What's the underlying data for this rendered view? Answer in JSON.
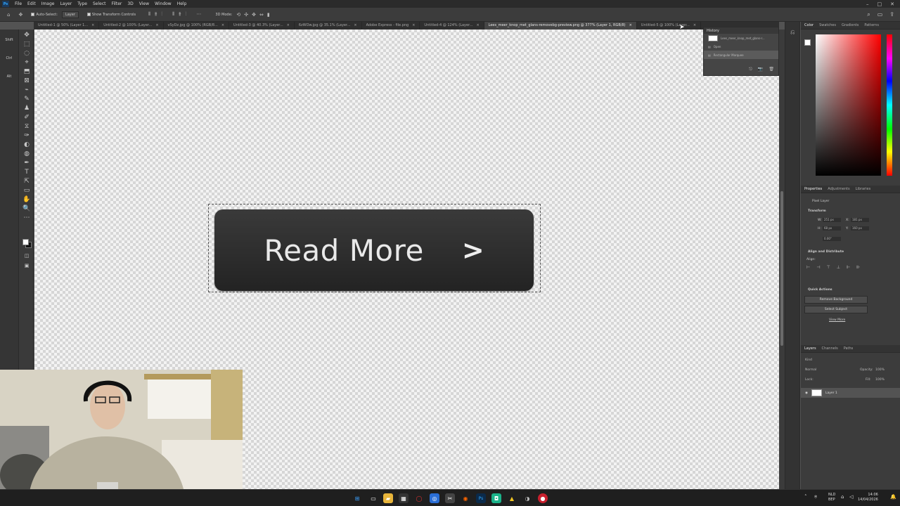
{
  "menubar": {
    "items": [
      "File",
      "Edit",
      "Image",
      "Layer",
      "Type",
      "Select",
      "Filter",
      "3D",
      "View",
      "Window",
      "Help"
    ],
    "win_controls": [
      "–",
      "□",
      "✕"
    ]
  },
  "options": {
    "auto_select_label": "Auto-Select:",
    "auto_select_value": "Layer",
    "transform_controls_label": "Show Transform Controls",
    "mode_3d_label": "3D Mode:"
  },
  "tabs": [
    {
      "label": "Untitled-1 @ 50% (Layer 1...",
      "active": false
    },
    {
      "label": "Untitled-2 @ 100% (Layer...",
      "active": false
    },
    {
      "label": "vSyDz.jpg @ 100% (RGB/8...",
      "active": false
    },
    {
      "label": "Untitled-3 @ 40.3% (Layer...",
      "active": false
    },
    {
      "label": "6zWOw.jpg @ 35.1% (Layer...",
      "active": false
    },
    {
      "label": "Adobe Express - file.png",
      "active": false
    },
    {
      "label": "Untitled-4 @ 124% (Layer...",
      "active": false
    },
    {
      "label": "Lees_meer_knop_met_glans-removebg-preview.png @ 377% (Layer 1, RGB/8)",
      "active": true
    },
    {
      "label": "Untitled-5 @ 100% (Layer...",
      "active": false
    }
  ],
  "tab_close": "×",
  "left_strip": [
    "Shift",
    "Ctrl",
    "Alt"
  ],
  "tools": [
    "✥",
    "⬚",
    "◌",
    "⌖",
    "⬒",
    "⊠",
    "⌁",
    "✎",
    "♟",
    "✐",
    "⧖",
    "✑",
    "◐",
    "◍",
    "✒",
    "T",
    "⇱",
    "▭",
    "✋",
    "🔍",
    "⋯"
  ],
  "canvas": {
    "button_text": "Read More",
    "button_chevron": ">"
  },
  "history": {
    "title": "History",
    "doc_name": "Lees_meer_knop_met_glans-r...",
    "items": [
      "Open",
      "Rectangular Marquee"
    ],
    "footer_icons": [
      "⎋",
      "📷",
      "🗑"
    ]
  },
  "color_panel": {
    "tabs": [
      "Color",
      "Swatches",
      "Gradients",
      "Patterns"
    ]
  },
  "properties": {
    "tabs": [
      "Properties",
      "Adjustments",
      "Libraries"
    ],
    "layer_type": "Pixel Layer",
    "transform_label": "Transform",
    "w_label": "W:",
    "w_value": "251 px",
    "h_label": "H:",
    "h_value": "68 px",
    "x_label": "X:",
    "x_value": "181 px",
    "y_label": "Y:",
    "y_value": "160 px",
    "angle_value": "0.00°",
    "align_label": "Align and Distribute",
    "align_sub": "Align:",
    "quick_actions_label": "Quick Actions",
    "remove_bg": "Remove Background",
    "select_subject": "Select Subject",
    "view_more": "View More"
  },
  "layers": {
    "tabs": [
      "Layers",
      "Channels",
      "Paths"
    ],
    "kind": "Kind",
    "blend_mode": "Normal",
    "opacity_label": "Opacity:",
    "opacity_value": "100%",
    "lock_label": "Lock:",
    "fill_label": "Fill:",
    "fill_value": "100%",
    "layer_name": "Layer 1"
  },
  "taskbar": {
    "lang": "NLD",
    "lang_sub": "BEP",
    "time": "14:06",
    "date": "14/04/2026"
  },
  "colors": {
    "accent": "#31a8ff",
    "button_bg": "#2b2b2b",
    "button_text": "#e9e9e9"
  }
}
